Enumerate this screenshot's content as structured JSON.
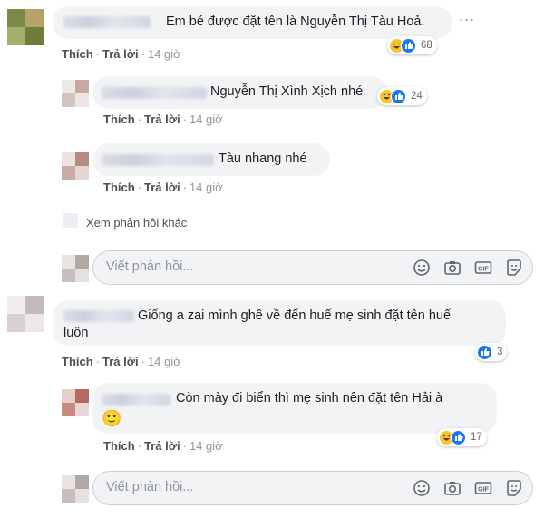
{
  "comments": [
    {
      "text": "Em bé được đặt tên là Nguyễn Thị Tàu Hoả.",
      "reactions": "68",
      "actions": {
        "like": "Thích",
        "reply": "Trả lời",
        "time": "14 giờ"
      },
      "replies": [
        {
          "text": "Nguyễn Thị Xình Xịch nhé",
          "reactions": "24",
          "actions": {
            "like": "Thích",
            "reply": "Trả lời",
            "time": "14 giờ"
          }
        },
        {
          "text": "Tàu nhang nhé",
          "actions": {
            "like": "Thích",
            "reply": "Trả lời",
            "time": "14 giờ"
          }
        }
      ],
      "see_more": "Xem phản hồi khác",
      "reply_placeholder": "Viết phản hồi..."
    },
    {
      "text_line1": "Giống a zai mình ghê về đến huế mẹ sinh đặt tên huế",
      "text_line2": "luôn",
      "reactions": "3",
      "actions": {
        "like": "Thích",
        "reply": "Trả lời",
        "time": "14 giờ"
      },
      "replies": [
        {
          "text": "Còn mày đi biển thì mẹ sinh nên đặt tên Hải à",
          "emoji": "🙂",
          "reactions": "17",
          "actions": {
            "like": "Thích",
            "reply": "Trả lời",
            "time": "14 giờ"
          }
        }
      ],
      "reply_placeholder": "Viết phản hồi..."
    }
  ],
  "more_options": "...",
  "icons": [
    "emoji-icon",
    "camera-icon",
    "gif-icon",
    "sticker-icon",
    "haha-reaction-icon",
    "like-reaction-icon"
  ],
  "colors": {
    "like_blue": "#1877f2",
    "haha_yellow": "#f7c431",
    "bubble_bg": "#f2f3f5"
  }
}
